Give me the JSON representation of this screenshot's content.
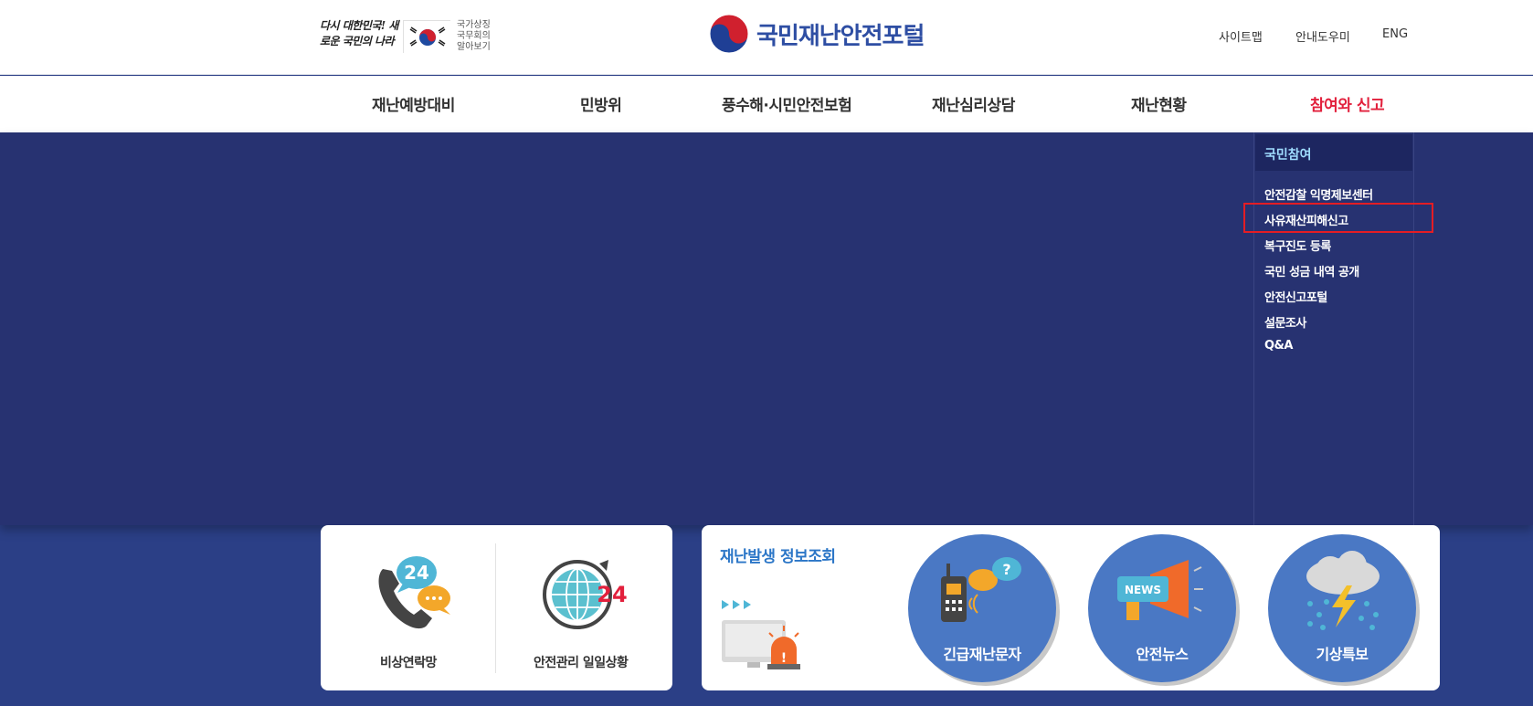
{
  "header": {
    "slogan": "다시 대한민국! 새로운 국민의 나라",
    "state_symbols": [
      "국가상징",
      "국무회의",
      "알아보기"
    ],
    "logo_text": "국민재난안전포털",
    "utility_links": [
      "사이트맵",
      "안내도우미",
      "ENG"
    ]
  },
  "nav": {
    "items": [
      "재난예방대비",
      "민방위",
      "풍수해·시민안전보험",
      "재난심리상담",
      "재난현황",
      "참여와 신고"
    ],
    "active_index": 5,
    "active_color": "#e2203c"
  },
  "dropdown": {
    "heading": "국민참여",
    "items": [
      "안전감찰 익명제보센터",
      "사유재산피해신고",
      "복구진도 등록",
      "국민 성금 내역 공개",
      "안전신고포털",
      "설문조사",
      "Q&A"
    ],
    "highlighted_index": 1
  },
  "quick_links": {
    "emergency_contacts": "비상연락망",
    "daily_safety": "안전관리 일일상황"
  },
  "disaster_info": {
    "title": "재난발생 정보조회",
    "buttons": [
      "긴급재난문자",
      "안전뉴스",
      "기상특보"
    ]
  },
  "colors": {
    "navy": "#273271",
    "brand_blue": "#2e4ea3",
    "circle_blue": "#4a78c4"
  }
}
